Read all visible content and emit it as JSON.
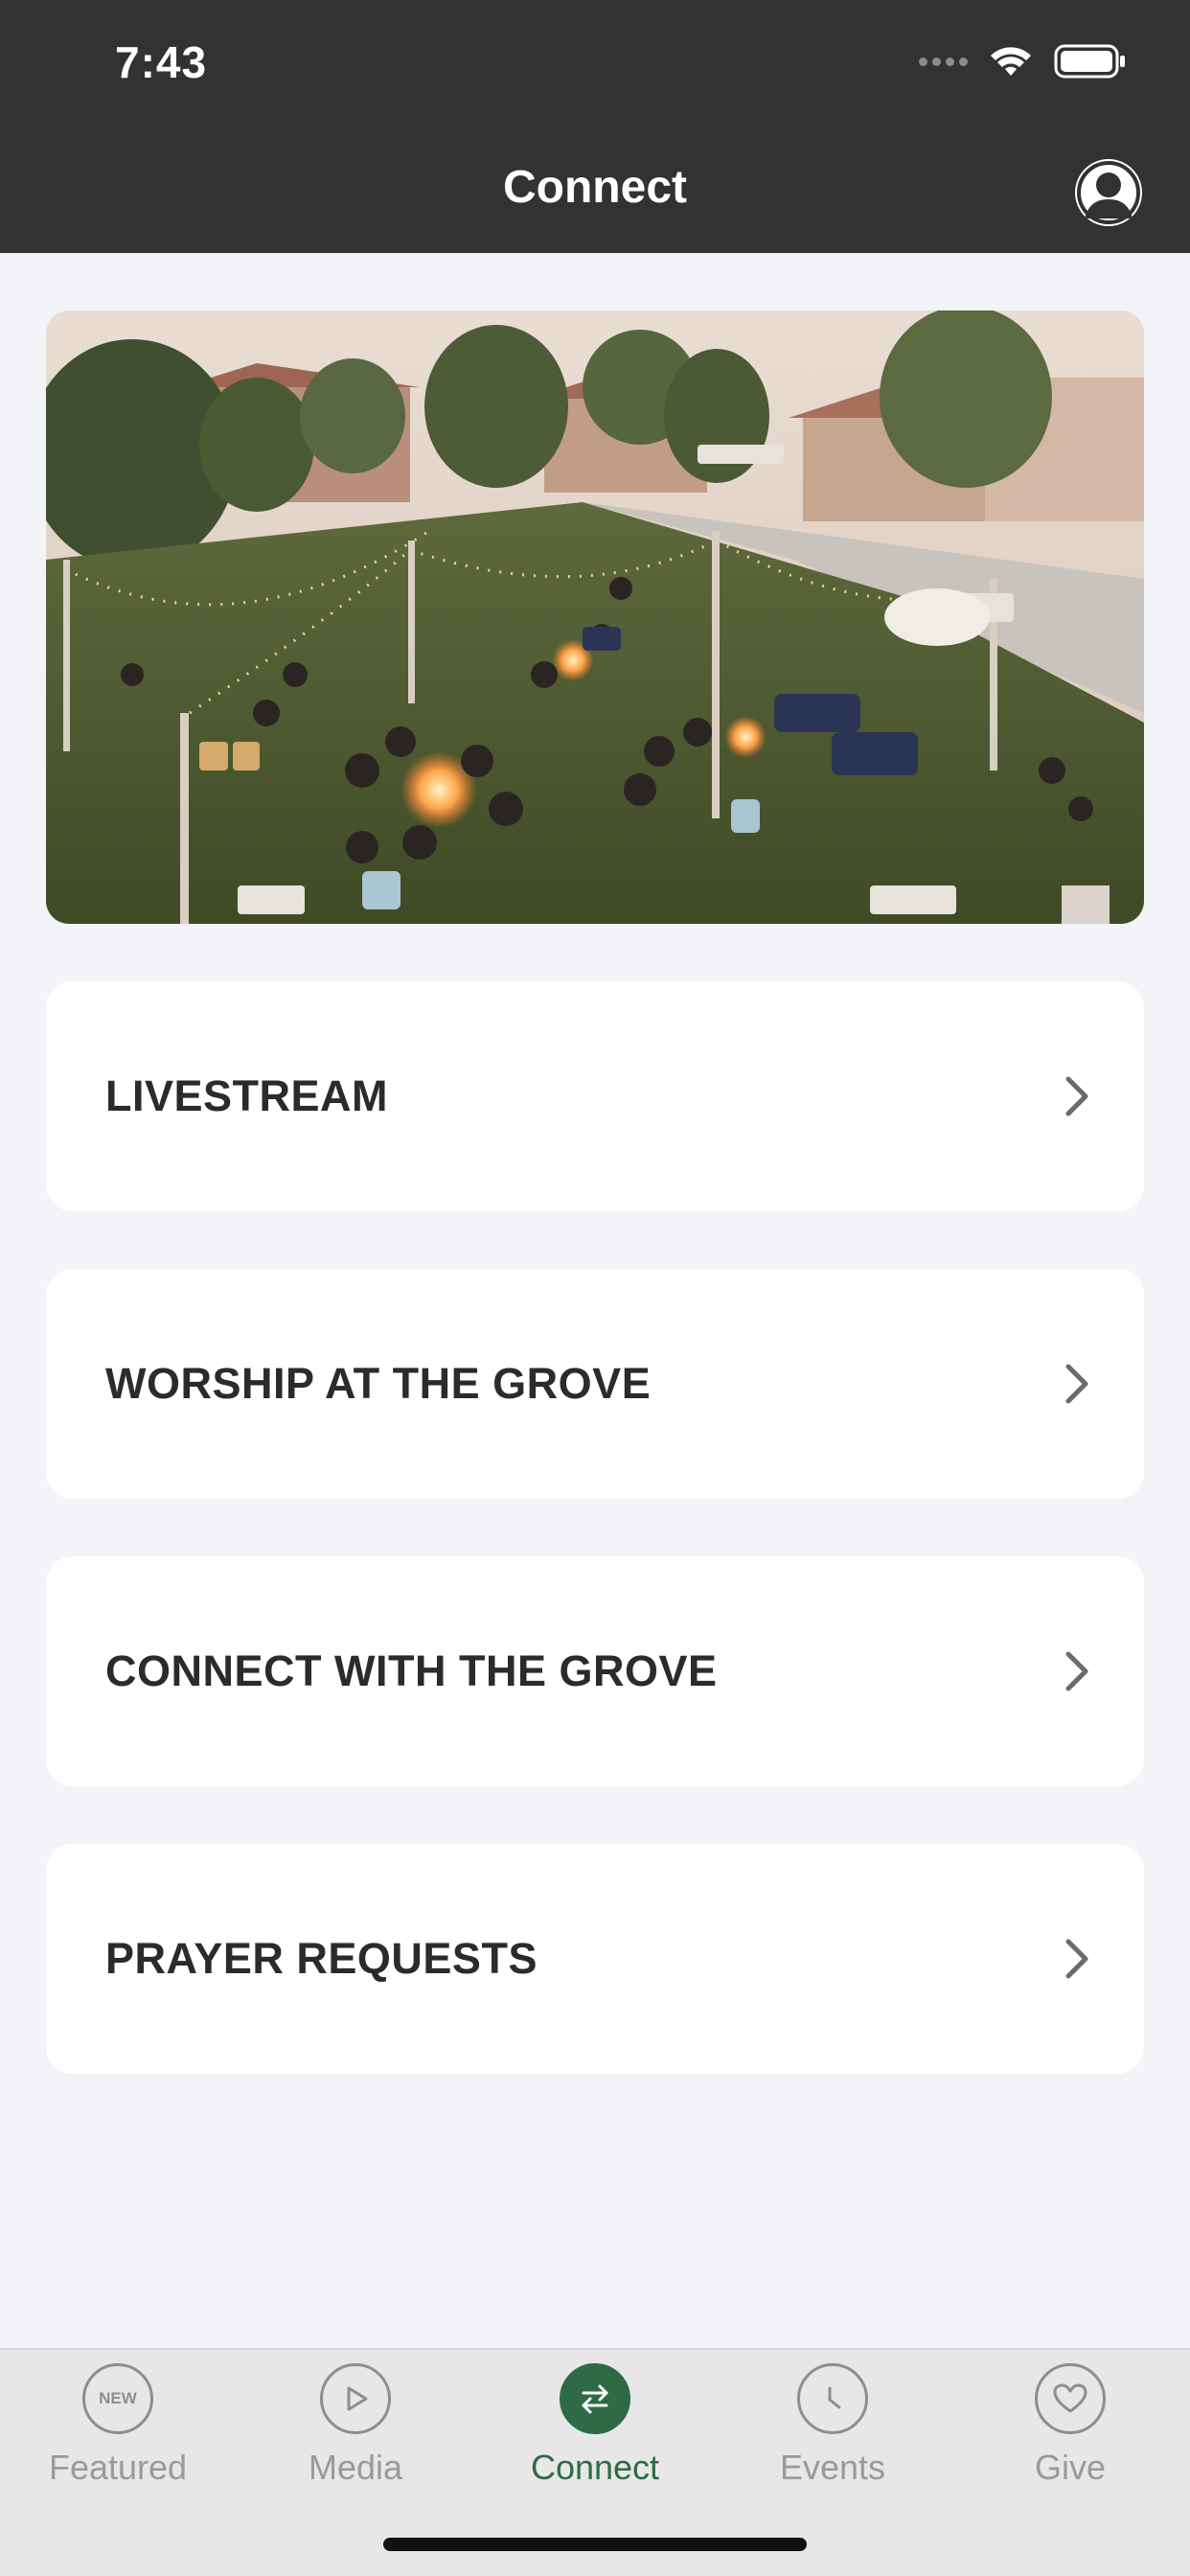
{
  "status_bar": {
    "time": "7:43"
  },
  "header": {
    "title": "Connect"
  },
  "menu": [
    {
      "label": "LIVESTREAM"
    },
    {
      "label": "WORSHIP AT THE GROVE"
    },
    {
      "label": "CONNECT WITH THE GROVE"
    },
    {
      "label": "PRAYER REQUESTS"
    }
  ],
  "tabs": [
    {
      "label": "Featured",
      "icon": "new-badge-icon",
      "icon_text": "NEW"
    },
    {
      "label": "Media",
      "icon": "play-icon"
    },
    {
      "label": "Connect",
      "icon": "transfer-arrows-icon",
      "active": true
    },
    {
      "label": "Events",
      "icon": "clock-icon"
    },
    {
      "label": "Give",
      "icon": "heart-icon"
    }
  ],
  "colors": {
    "accent": "#2e6b45",
    "header": "#323232",
    "background": "#f3f4f8"
  }
}
